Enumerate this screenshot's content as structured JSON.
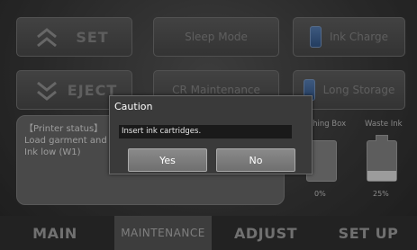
{
  "buttons": {
    "set": "SET",
    "eject": "EJECT",
    "sleep_mode": "Sleep Mode",
    "cr_maintenance": "CR Maintenance",
    "ink_charge": "Ink Charge",
    "long_storage": "Long Storage"
  },
  "status_panel": {
    "heading": "【Printer status】",
    "line1": "Load garment and",
    "line2": "Ink low (W1)"
  },
  "waste": {
    "flushing_box_label": "Flushing Box",
    "waste_ink_label": "Waste Ink",
    "flushing_box_percent": "0%",
    "waste_ink_percent": "25%",
    "flushing_box_level": 0.0,
    "waste_ink_level": 0.25
  },
  "tabs": {
    "main": "MAIN",
    "maintenance": "MAINTENANCE",
    "adjust": "ADJUST",
    "setup": "SET UP"
  },
  "dialog": {
    "title": "Caution",
    "message": "Insert ink cartridges.",
    "yes": "Yes",
    "no": "No"
  },
  "icons": {
    "set": "chevron-double-up-icon",
    "eject": "chevron-double-down-icon",
    "ink": "ink-cartridge-icon"
  },
  "colors": {
    "background": "#3e3e3e",
    "button": "#5a5a5a",
    "dialog": "#3a3a3a",
    "ink_icon": "#3f71b8"
  }
}
